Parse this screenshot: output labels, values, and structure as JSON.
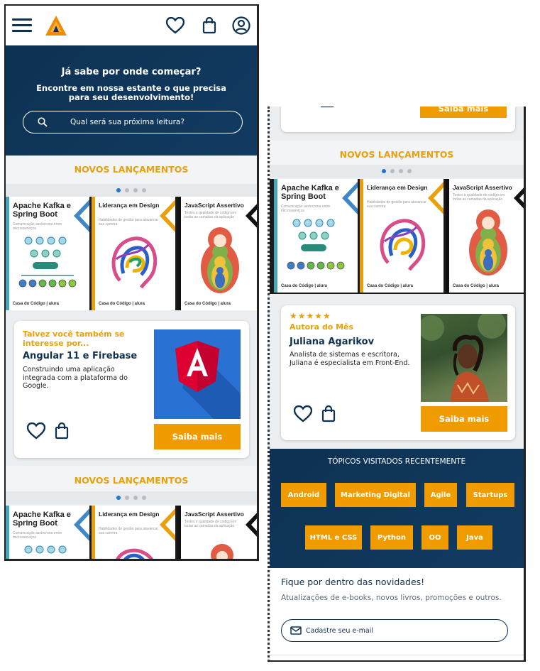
{
  "header": {
    "menu_icon": "hamburger-menu-icon",
    "logo_icon": "triangle-logo-icon",
    "wishlist_icon": "heart-icon",
    "cart_icon": "shopping-bag-icon",
    "account_icon": "user-circle-icon"
  },
  "hero": {
    "title": "Já sabe por onde começar?",
    "subtitle": "Encontre em nossa estante o que precisa para seu desenvolvimento!",
    "search_placeholder": "Qual será sua próxima leitura?"
  },
  "sections": {
    "new_releases": "NOVOS LANÇAMENTOS",
    "recent_topics": "TÓPICOS VISITADOS RECENTEMENTE"
  },
  "books": [
    {
      "title": "Apache Kafka e Spring Boot",
      "subtitle": "Comunicação assíncrona entre microsserviços",
      "color": "#4aa7b8",
      "brand": "Casa do Código | alura"
    },
    {
      "title": "Liderança em Design",
      "subtitle": "Habilidades de gestão para alavancar sua carreira",
      "color": "#e8a10d",
      "brand": "Casa do Código | alura"
    },
    {
      "title": "JavaScript Assertivo",
      "subtitle": "Testes e qualidade de código em todas as camadas da aplicação",
      "color": "#111111",
      "brand": "Casa do Código | alura"
    }
  ],
  "suggestion": {
    "eyebrow": "Talvez você também se interesse por...",
    "title": "Angular 11 e Firebase",
    "description": "Construindo uma aplicação integrada com a plataforma do Google.",
    "button": "Saiba mais"
  },
  "author": {
    "stars": "★★★★★",
    "eyebrow": "Autora do Mês",
    "name": "Juliana Agarikov",
    "description": "Analista de sistemas e escritora, Juliana é especialista em Front-End.",
    "button": "Saiba mais"
  },
  "right_top_button": "Saiba mais",
  "topics": [
    "Android",
    "Marketing Digital",
    "Agile",
    "Startups",
    "HTML e CSS",
    "Python",
    "OO",
    "Java"
  ],
  "newsletter": {
    "title": "Fique por dentro das novidades!",
    "description": "Atualizações de e-books, novos livros, promoções e outros.",
    "placeholder": "Cadastre seu e-mail"
  },
  "colors": {
    "navy": "#0f3251",
    "orange": "#f09c00",
    "accent_text": "#e8a10d",
    "dot_active": "#1f74d6"
  }
}
